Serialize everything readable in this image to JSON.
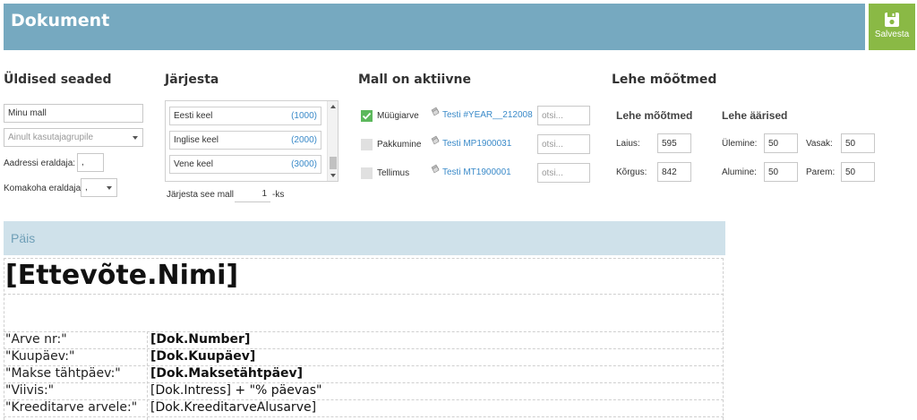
{
  "header": {
    "title": "Dokument",
    "save_label": "Salvesta",
    "colors": {
      "bar": "#76a9c0",
      "save": "#8ab945"
    }
  },
  "general": {
    "title": "Üldised seaded",
    "template_name": "Minu mall",
    "usergroup_placeholder": "Ainult kasutajagrupile",
    "address_separator_label": "Aadressi eraldaja:",
    "address_separator_value": ",",
    "decimal_separator_label": "Komakoha eraldaja:",
    "decimal_separator_value": ","
  },
  "order": {
    "title": "Järjesta",
    "languages": [
      {
        "name": "Eesti keel",
        "code": "(1000)"
      },
      {
        "name": "Inglise keel",
        "code": "(2000)"
      },
      {
        "name": "Vene keel",
        "code": "(3000)"
      }
    ],
    "order_prefix": "Järjesta see mall",
    "order_value": "1",
    "order_suffix": "-ks"
  },
  "active": {
    "title": "Mall on aktiivne",
    "items": [
      {
        "label": "Müügiarve",
        "checked": true,
        "link": "Testi #YEAR__212008",
        "search_placeholder": "otsi..."
      },
      {
        "label": "Pakkumine",
        "checked": false,
        "link": "Testi MP1900031",
        "search_placeholder": "otsi..."
      },
      {
        "label": "Tellimus",
        "checked": false,
        "link": "Testi MT1900001",
        "search_placeholder": "otsi..."
      }
    ]
  },
  "page": {
    "title": "Lehe mõõtmed",
    "dims_title": "Lehe mõõtmed",
    "width_label": "Laius:",
    "width_value": "595",
    "height_label": "Kõrgus:",
    "height_value": "842",
    "margins_title": "Lehe äärised",
    "top_label": "Ülemine:",
    "top_value": "50",
    "left_label": "Vasak:",
    "left_value": "50",
    "bottom_label": "Alumine:",
    "bottom_value": "50",
    "right_label": "Parem:",
    "right_value": "50"
  },
  "header_section": {
    "title": "Päis",
    "company": "[Ettevõte.Nimi]",
    "rows": [
      {
        "label": "\"Arve nr:\"",
        "value": "[Dok.Number]",
        "bold": true
      },
      {
        "label": "\"Kuupäev:\"",
        "value": "[Dok.Kuupäev]",
        "bold": true
      },
      {
        "label": "\"Makse tähtpäev:\"",
        "value": "[Dok.Maksetähtpäev]",
        "bold": true
      },
      {
        "label": "\"Viivis:\"",
        "value": "[Dok.Intress] + \"% päevas\"",
        "bold": false
      },
      {
        "label": "\"Kreeditarve arvele:\"",
        "value": "[Dok.KreeditarveAlusarve]",
        "bold": false
      }
    ]
  }
}
